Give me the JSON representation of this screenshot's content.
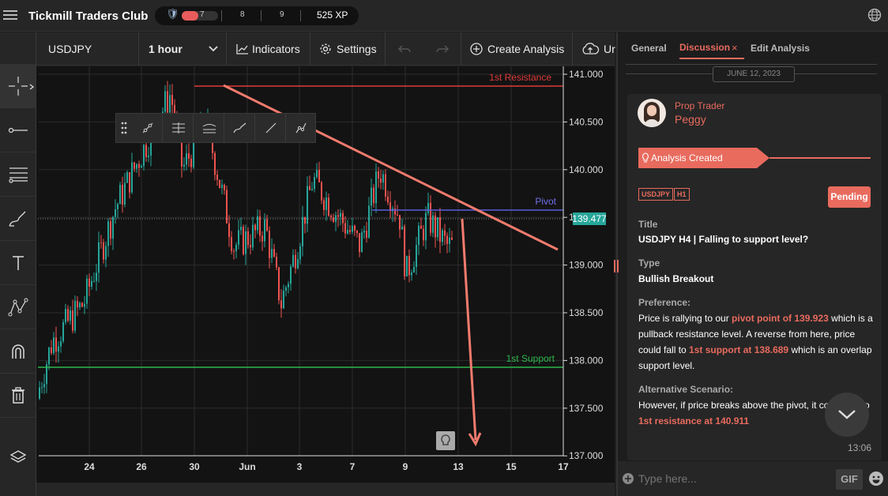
{
  "app": {
    "title": "Tickmill Traders Club"
  },
  "xp": {
    "levels": [
      "7",
      "8",
      "9"
    ],
    "points": "525 XP",
    "progress": 0.45
  },
  "toolbar": {
    "symbol": "USDJPY",
    "interval": "1 hour",
    "indicators": "Indicators",
    "settings": "Settings",
    "create_analysis": "Create Analysis",
    "upload": "Ur"
  },
  "chart": {
    "y_ticks": [
      "141.000",
      "140.500",
      "140.000",
      "139.500",
      "139.000",
      "138.500",
      "138.000",
      "137.500",
      "137.000"
    ],
    "x_ticks": [
      "24",
      "26",
      "30",
      "Jun",
      "3",
      "7",
      "9",
      "13",
      "15",
      "17"
    ],
    "resistance_label": "1st Resistance",
    "pivot_label": "Pivot",
    "support_label": "1st Support",
    "price_label": "139.477",
    "colors": {
      "up": "#26a69a",
      "down": "#ef5350",
      "resistance": "#e03a3a",
      "pivot": "#5c5ce0",
      "support": "#2db84d",
      "trend": "#f27b6e"
    }
  },
  "panel": {
    "tabs": [
      "General",
      "Discussion",
      "Edit Analysis"
    ],
    "date": "JUNE 12, 2023",
    "author_role": "Prop Trader",
    "author_name": "Peggy",
    "banner": "Analysis Created",
    "tags": [
      "USDJPY",
      "H1"
    ],
    "status": "Pending",
    "title_label": "Title",
    "title_value": "USDJPY H4 | Falling to support level?",
    "type_label": "Type",
    "type_value": "Bullish Breakout",
    "pref_label": "Preference:",
    "pref_text_1": "Price is rallying to our ",
    "pref_hl_1": "pivot point of 139.923",
    "pref_text_2": " which is a pullback resistance level. A reverse from here, price could fall to ",
    "pref_hl_2": "1st support at 138.689",
    "pref_text_3": " which is an overlap support level.",
    "alt_label": "Alternative Scenario:",
    "alt_text": "However, if price breaks above the pivot, it co",
    "alt_text_tail": "o",
    "alt_hl": "1st resistance at 140.911",
    "time": "13:06",
    "input_placeholder": "Type here...",
    "gif": "GIF"
  }
}
